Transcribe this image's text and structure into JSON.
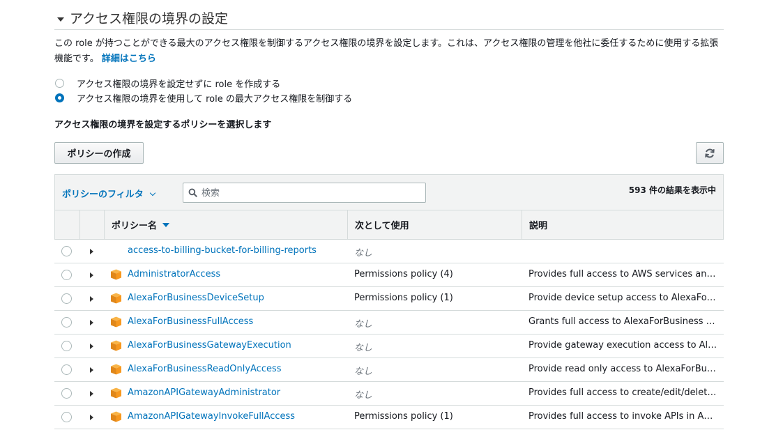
{
  "section": {
    "title": "アクセス権限の境界の設定",
    "description": "この role が持つことができる最大のアクセス権限を制御するアクセス権限の境界を設定します。これは、アクセス権限の管理を他社に委任するために使用する拡張機能です。",
    "details_link": "詳細はこちら"
  },
  "options": [
    {
      "label": "アクセス権限の境界を設定せずに role を作成する",
      "checked": false
    },
    {
      "label": "アクセス権限の境界を使用して role の最大アクセス権限を制御する",
      "checked": true
    }
  ],
  "policy_select_heading": "アクセス権限の境界を設定するポリシーを選択します",
  "toolbar": {
    "create_label": "ポリシーの作成",
    "refresh_icon": "refresh-icon"
  },
  "filter": {
    "label": "ポリシーのフィルタ",
    "search_placeholder": "検索",
    "result_count": "593 件の結果を表示中"
  },
  "columns": {
    "name": "ポリシー名",
    "usage": "次として使用",
    "description": "説明"
  },
  "rows": [
    {
      "name": "access-to-billing-bucket-for-billing-reports",
      "usage": "なし",
      "description": "",
      "icon": false
    },
    {
      "name": "AdministratorAccess",
      "usage": "Permissions policy (4)",
      "description": "Provides full access to AWS services an…",
      "icon": true
    },
    {
      "name": "AlexaForBusinessDeviceSetup",
      "usage": "Permissions policy (1)",
      "description": "Provide device setup access to AlexaFor…",
      "icon": true
    },
    {
      "name": "AlexaForBusinessFullAccess",
      "usage": "なし",
      "description": "Grants full access to AlexaForBusiness r…",
      "icon": true
    },
    {
      "name": "AlexaForBusinessGatewayExecution",
      "usage": "なし",
      "description": "Provide gateway execution access to Al…",
      "icon": true
    },
    {
      "name": "AlexaForBusinessReadOnlyAccess",
      "usage": "なし",
      "description": "Provide read only access to AlexaForBu…",
      "icon": true
    },
    {
      "name": "AmazonAPIGatewayAdministrator",
      "usage": "なし",
      "description": "Provides full access to create/edit/delete…",
      "icon": true
    },
    {
      "name": "AmazonAPIGatewayInvokeFullAccess",
      "usage": "Permissions policy (1)",
      "description": "Provides full access to invoke APIs in A…",
      "icon": true
    }
  ],
  "colors": {
    "link": "#0073bb",
    "radio_checked": "#0073bb",
    "policy_icon": "#f7981f",
    "header_bg": "#f2f3f3"
  }
}
